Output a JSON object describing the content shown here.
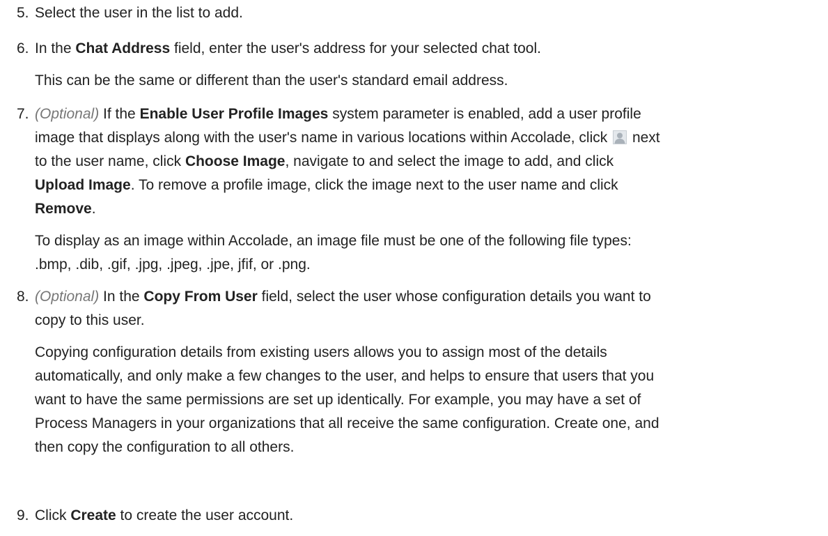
{
  "steps": [
    {
      "num": "5.",
      "text": "Select the user in the list to add."
    },
    {
      "num": "6.",
      "p1": {
        "a": "In the ",
        "b1": "Chat Address",
        "c": " field, enter the user's address for your selected chat tool."
      },
      "p2": "This can be the same or different than the user's standard email address."
    },
    {
      "num": "7.",
      "p1": {
        "optional": "(Optional)",
        "a": " If the ",
        "b1": "Enable User Profile Images",
        "c": " system parameter is enabled, add a user profile",
        "line2_a": "image that displays along with the user's name in various locations within Accolade, click",
        "line2_b": " next",
        "line3_a": "to the user name, click ",
        "b2": "Choose Image",
        "line3_b": ", navigate to and select the image to add, and click",
        "b3": "Upload Image",
        "line4_a": ". To remove a profile image, click the image next to the user name and click",
        "b4": "Remove",
        "line5_a": "."
      },
      "p2_line1": "To display as an image within Accolade, an image file must be one of the following file types:",
      "p2_line2": ".bmp, .dib, .gif, .jpg, .jpeg, .jpe, jfif, or .png."
    },
    {
      "num": "8.",
      "p1": {
        "optional": "(Optional)",
        "a": " In the ",
        "b1": "Copy From User",
        "c": " field, select the user whose configuration details you want to",
        "line2": "copy to this user."
      },
      "p2_lines": [
        "Copying configuration details from existing users allows you to assign most of the details",
        "automatically, and only make a few changes to the user, and helps to ensure that users that you",
        "want to have the same permissions are set up identically. For example, you may have a set of",
        "Process Managers in your organizations that all receive the same configuration. Create one, and",
        "then copy the configuration to all others."
      ]
    },
    {
      "num": "9.",
      "a": "Click ",
      "b1": "Create",
      "c": " to create the user account."
    }
  ],
  "icons": {
    "profile": "user-profile-placeholder-icon"
  }
}
